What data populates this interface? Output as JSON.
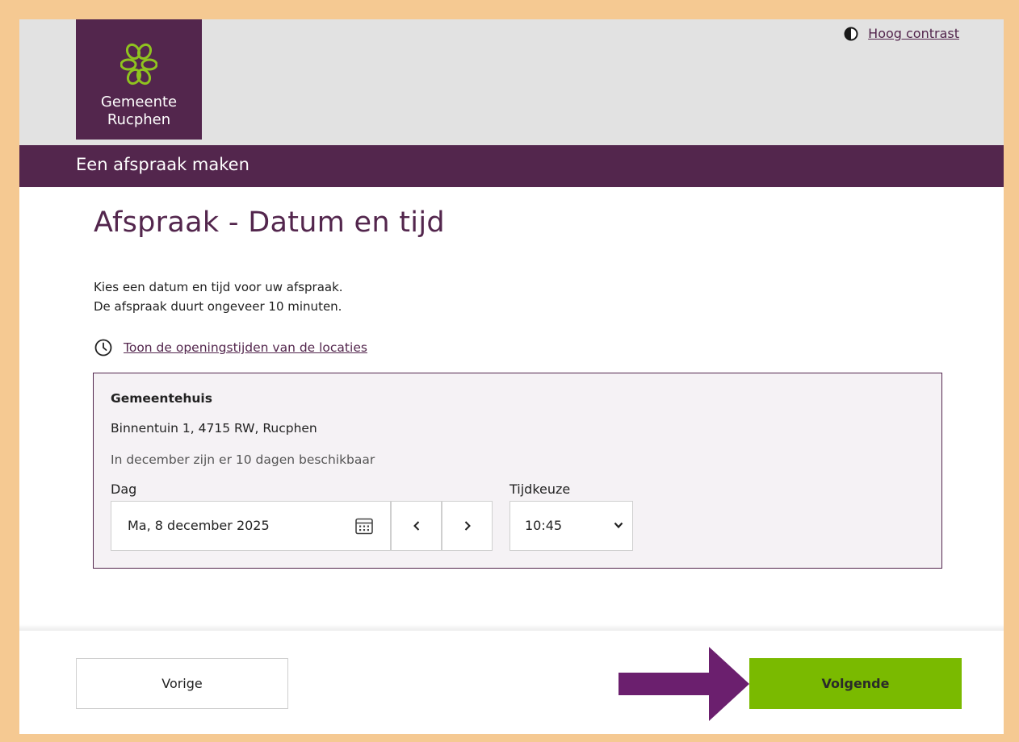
{
  "header": {
    "logo_line1": "Gemeente",
    "logo_line2": "Rucphen",
    "contrast_link": "Hoog contrast"
  },
  "band": {
    "title": "Een afspraak maken"
  },
  "main": {
    "heading": "Afspraak - Datum en tijd",
    "intro_line1": "Kies een datum en tijd voor uw afspraak.",
    "intro_line2": "De afspraak duurt ongeveer 10 minuten.",
    "hours_link": "Toon de openingstijden van de locaties"
  },
  "location": {
    "name": "Gemeentehuis",
    "address": "Binnentuin 1, 4715 RW, Rucphen",
    "availability": "In december zijn er 10 dagen beschikbaar",
    "day_label": "Dag",
    "day_value": "Ma, 8 december 2025",
    "time_label": "Tijdkeuze",
    "time_value": "10:45"
  },
  "footer": {
    "prev_label": "Vorige",
    "next_label": "Volgende"
  },
  "colors": {
    "brand": "#53264d",
    "accent_green": "#7aba00",
    "frame": "#f5c992",
    "arrow": "#6b1f6e"
  },
  "icons": [
    "logo-flower-icon",
    "contrast-icon",
    "clock-icon",
    "calendar-icon",
    "chevron-left-icon",
    "chevron-right-icon",
    "chevron-down-icon",
    "arrow-right-icon"
  ]
}
